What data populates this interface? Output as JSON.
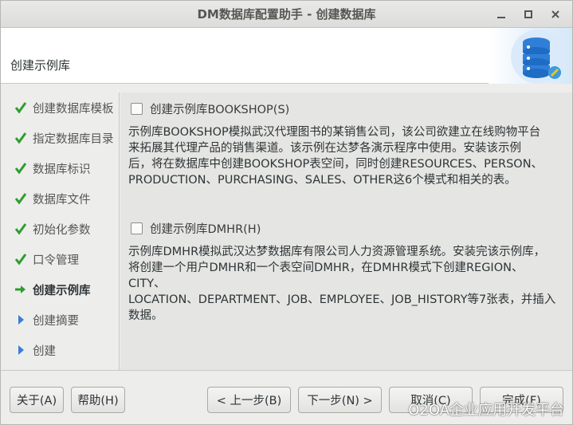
{
  "window": {
    "title": "DM数据库配置助手 - 创建数据库"
  },
  "header": {
    "heading": "创建示例库"
  },
  "steps": [
    {
      "label": "创建数据库模板",
      "status": "done"
    },
    {
      "label": "指定数据库目录",
      "status": "done"
    },
    {
      "label": "数据库标识",
      "status": "done"
    },
    {
      "label": "数据库文件",
      "status": "done"
    },
    {
      "label": "初始化参数",
      "status": "done"
    },
    {
      "label": "口令管理",
      "status": "done"
    },
    {
      "label": "创建示例库",
      "status": "current"
    },
    {
      "label": "创建摘要",
      "status": "pending"
    },
    {
      "label": "创建",
      "status": "pending"
    }
  ],
  "options": {
    "bookshop": {
      "label": "创建示例库BOOKSHOP(S)",
      "checked": false,
      "desc_lines": [
        "示例库BOOKSHOP模拟武汉代理图书的某销售公司，该公司欲建立在线购物平台",
        "来拓展其代理产品的销售渠道。该示例在达梦各演示程序中使用。安装该示例",
        "后，将在数据库中创建BOOKSHOP表空间，同时创建RESOURCES、PERSON、",
        "PRODUCTION、PURCHASING、SALES、OTHER这6个模式和相关的表。"
      ]
    },
    "dmhr": {
      "label": "创建示例库DMHR(H)",
      "checked": false,
      "desc_lines": [
        "示例库DMHR模拟武汉达梦数据库有限公司人力资源管理系统。安装完该示例库，",
        "将创建一个用户DMHR和一个表空间DMHR，在DMHR模式下创建REGION、CITY、",
        "LOCATION、DEPARTMENT、JOB、EMPLOYEE、JOB_HISTORY等7张表，并插入",
        "数据。"
      ]
    }
  },
  "footer": {
    "about": "关于(A)",
    "help": "帮助(H)",
    "prev": "< 上一步(B)",
    "next": "下一步(N) >",
    "cancel": "取消(C)",
    "finish": "完成(F)"
  },
  "watermark": "O2OA企业应用开发平台",
  "colors": {
    "check": "#2e9d2e",
    "arrow_current": "#2e9d2e",
    "arrow_pending": "#3b7fd4"
  },
  "icons": {
    "done": "checkmark-icon",
    "current": "arrow-right-icon",
    "pending": "triangle-right-icon"
  }
}
